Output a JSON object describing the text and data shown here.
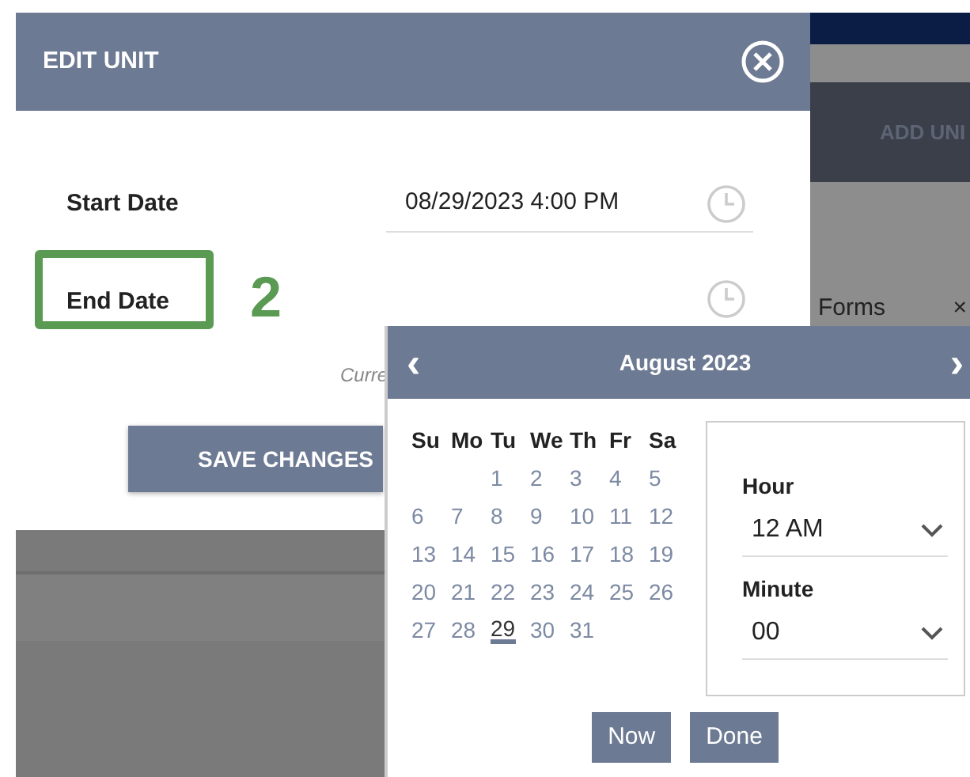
{
  "modal": {
    "title": "EDIT UNIT",
    "fields": [
      {
        "label": "Start Date",
        "value": "08/29/2023 4:00 PM"
      },
      {
        "label": "End Date"
      }
    ],
    "note": "Curre",
    "save_button": "SAVE CHANGES"
  },
  "background": {
    "add_button": "ADD UNI",
    "tab": {
      "label": "Forms",
      "close": "×"
    }
  },
  "annotation": {
    "number": "2"
  },
  "datepicker": {
    "prev": "‹",
    "title": "August 2023",
    "next": "›",
    "weekdays": [
      "Su",
      "Mo",
      "Tu",
      "We",
      "Th",
      "Fr",
      "Sa"
    ],
    "weeks": [
      [
        {
          "day": "1",
          "selected": false
        },
        {
          "day": "2",
          "selected": false
        },
        {
          "day": "3",
          "selected": false
        },
        {
          "day": "4",
          "selected": false
        },
        {
          "day": "5",
          "selected": false
        }
      ],
      [
        {
          "day": "6",
          "selected": false
        },
        {
          "day": "7",
          "selected": false
        },
        {
          "day": "8",
          "selected": false
        },
        {
          "day": "9",
          "selected": false
        },
        {
          "day": "10",
          "selected": false
        },
        {
          "day": "11",
          "selected": false
        },
        {
          "day": "12",
          "selected": false
        }
      ],
      [
        {
          "day": "13",
          "selected": false
        },
        {
          "day": "14",
          "selected": false
        },
        {
          "day": "15",
          "selected": false
        },
        {
          "day": "16",
          "selected": false
        },
        {
          "day": "17",
          "selected": false
        },
        {
          "day": "18",
          "selected": false
        },
        {
          "day": "19",
          "selected": false
        }
      ],
      [
        {
          "day": "20",
          "selected": false
        },
        {
          "day": "21",
          "selected": false
        },
        {
          "day": "22",
          "selected": false
        },
        {
          "day": "23",
          "selected": false
        },
        {
          "day": "24",
          "selected": false
        },
        {
          "day": "25",
          "selected": false
        },
        {
          "day": "26",
          "selected": false
        }
      ],
      [
        {
          "day": "27",
          "selected": false
        },
        {
          "day": "28",
          "selected": false
        },
        {
          "day": "29",
          "selected": true
        },
        {
          "day": "30",
          "selected": false
        },
        {
          "day": "31",
          "selected": false
        }
      ]
    ],
    "time": [
      {
        "label": "Hour",
        "value": "12 AM"
      },
      {
        "label": "Minute",
        "value": "00"
      }
    ],
    "buttons": [
      "Now",
      "Done"
    ]
  }
}
